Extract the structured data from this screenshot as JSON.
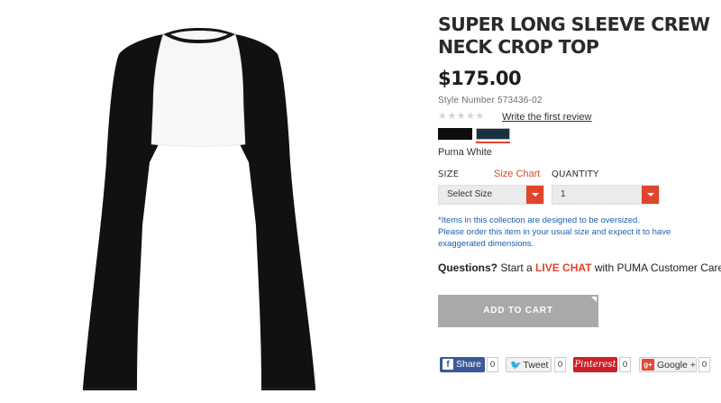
{
  "product": {
    "title": "SUPER LONG SLEEVE CREW NECK CROP TOP",
    "price": "$175.00",
    "style_label": "Style Number",
    "style_number": "573436-02",
    "stars": "★★★★★",
    "review_link": "Write the first review",
    "color_name": "Puma White"
  },
  "options": {
    "size_label": "SIZE",
    "size_chart": "Size Chart",
    "quantity_label": "QUANTITY",
    "size_select": "Select Size",
    "quantity_select": "1"
  },
  "note": {
    "line1": "*Items in this collection are designed to be oversized.",
    "line2": "Please order this item in your usual size and expect it to have exaggerated dimensions."
  },
  "questions": {
    "lead": "Questions?",
    "text_before": " Start a ",
    "live_chat": "LIVE CHAT",
    "text_after": " with PUMA Customer Care."
  },
  "cart": {
    "button_label": "ADD TO CART"
  },
  "share": {
    "facebook_label": "Share",
    "facebook_count": "0",
    "twitter_label": "Tweet",
    "twitter_count": "0",
    "pinterest_label": "Pinterest",
    "pinterest_count": "0",
    "googleplus_label": "Google +",
    "googleplus_count": "0"
  },
  "colors": {
    "accent": "#e0452b",
    "link_blue": "#1a5fb4",
    "facebook": "#3b5998",
    "pinterest": "#cb2027",
    "button_gray": "#a9a9a9"
  }
}
